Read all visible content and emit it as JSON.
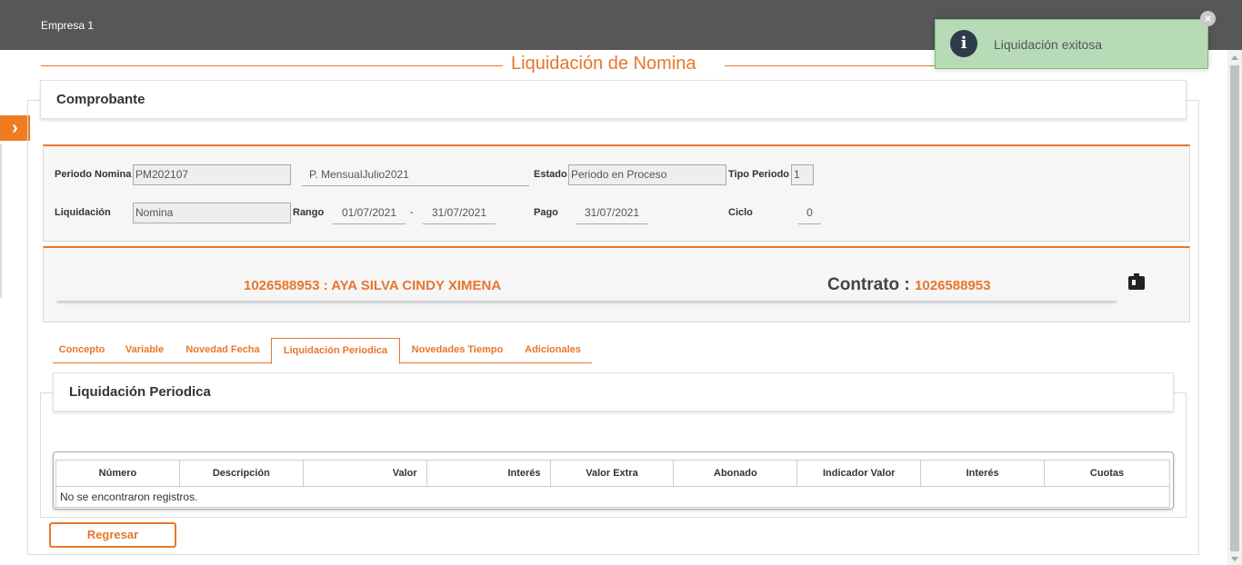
{
  "header": {
    "company": "Empresa 1"
  },
  "page": {
    "title": "Liquidación de Nomina"
  },
  "toast": {
    "message": "Liquidación exitosa",
    "icon": "info-icon",
    "color": "#b6dbb6"
  },
  "comprobante": {
    "title": "Comprobante"
  },
  "periodo": {
    "periodo_nomina_label": "Periodo Nomina",
    "periodo_nomina_value": "PM202107",
    "periodo_desc": "P. MensualJulio2021",
    "estado_label": "Estado",
    "estado_value": "Periodo en Proceso",
    "tipo_periodo_label": "Tipo Periodo",
    "tipo_periodo_value": "1",
    "liquidacion_label": "Liquidación",
    "liquidacion_value": "Nomina",
    "rango_label": "Rango",
    "rango_desde": "01/07/2021",
    "rango_sep": "-",
    "rango_hasta": "31/07/2021",
    "pago_label": "Pago",
    "pago_value": "31/07/2021",
    "ciclo_label": "Ciclo",
    "ciclo_value": "0"
  },
  "empleado": {
    "nombre": "1026588953 : AYA SILVA CINDY XIMENA",
    "contrato_label": "Contrato :",
    "contrato_value": "1026588953"
  },
  "tabs": [
    {
      "label": "Concepto"
    },
    {
      "label": "Variable"
    },
    {
      "label": "Novedad Fecha"
    },
    {
      "label": "Liquidación Periodica",
      "active": true
    },
    {
      "label": "Novedades Tiempo"
    },
    {
      "label": "Adicionales"
    }
  ],
  "section": {
    "title": "Liquidación Periodica"
  },
  "table": {
    "columns": [
      "Número",
      "Descripción",
      "Valor",
      "Interés",
      "Valor Extra",
      "Abonado",
      "Indicador Valor",
      "Interés",
      "Cuotas"
    ],
    "empty_message": "No se encontraron registros."
  },
  "actions": {
    "back_label": "Regresar"
  },
  "colors": {
    "accent": "#e8762b",
    "topbar": "#575757"
  }
}
